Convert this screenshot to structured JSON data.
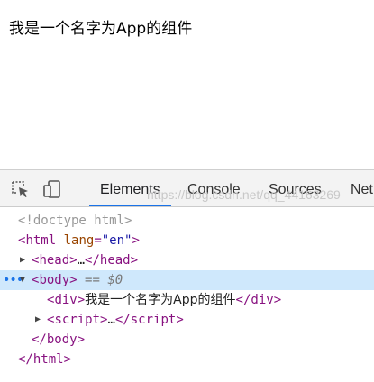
{
  "page": {
    "content_text": "我是一个名字为App的组件"
  },
  "devtools": {
    "tabs": [
      {
        "label": "Elements",
        "active": true
      },
      {
        "label": "Console",
        "active": false
      },
      {
        "label": "Sources",
        "active": false
      },
      {
        "label": "Net",
        "active": false
      }
    ],
    "dom": {
      "doctype": "<!doctype html>",
      "html_open_tag": "html",
      "html_attr_name": "lang",
      "html_attr_value": "\"en\"",
      "head_tag": "head",
      "head_ellipsis": "…",
      "body_tag": "body",
      "body_selected_marker": "== $0",
      "div_tag": "div",
      "div_text": "我是一个名字为App的组件",
      "script_tag": "script",
      "script_ellipsis": "…",
      "body_close_tag": "body",
      "html_close_tag": "html"
    }
  },
  "watermark": "https://blog.csdn.net/qq_44163269",
  "colors": {
    "accent": "#1a73e8",
    "selected_row": "#cfe8fc",
    "tag": "#881280"
  }
}
